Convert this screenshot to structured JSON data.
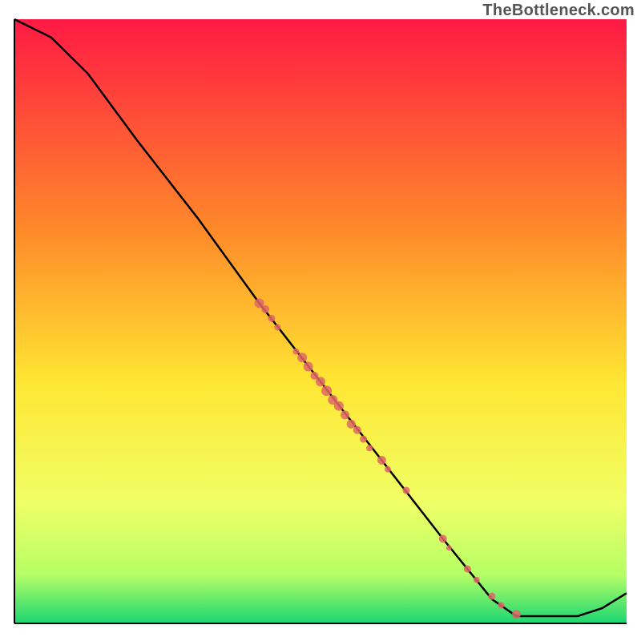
{
  "watermark": "TheBottleneck.com",
  "colors": {
    "gradient_top": "#ff1a44",
    "gradient_mid_upper": "#ff8a2a",
    "gradient_mid": "#ffe633",
    "gradient_mid_lower": "#f0ff66",
    "gradient_lower": "#b5ff66",
    "gradient_bottom": "#1bd672",
    "curve": "#000000",
    "dots": "#e06666",
    "axes": "#000000"
  },
  "chart_data": {
    "type": "line",
    "title": "",
    "xlabel": "",
    "ylabel": "",
    "xlim": [
      0,
      100
    ],
    "ylim": [
      0,
      100
    ],
    "curves": [
      {
        "name": "bottleneck_curve",
        "points": [
          {
            "x": 0,
            "y": 100
          },
          {
            "x": 6,
            "y": 97
          },
          {
            "x": 12,
            "y": 91
          },
          {
            "x": 20,
            "y": 80
          },
          {
            "x": 30,
            "y": 67
          },
          {
            "x": 40,
            "y": 53
          },
          {
            "x": 50,
            "y": 40
          },
          {
            "x": 60,
            "y": 27
          },
          {
            "x": 70,
            "y": 14
          },
          {
            "x": 78,
            "y": 4
          },
          {
            "x": 82,
            "y": 1.2
          },
          {
            "x": 86,
            "y": 1.2
          },
          {
            "x": 92,
            "y": 1.2
          },
          {
            "x": 96,
            "y": 2.5
          },
          {
            "x": 100,
            "y": 5
          }
        ]
      }
    ],
    "scatter_points": [
      {
        "x": 40,
        "y": 53,
        "size": 12
      },
      {
        "x": 41,
        "y": 52,
        "size": 10
      },
      {
        "x": 42,
        "y": 50.5,
        "size": 9
      },
      {
        "x": 43,
        "y": 49,
        "size": 8
      },
      {
        "x": 46,
        "y": 45,
        "size": 8
      },
      {
        "x": 47,
        "y": 44,
        "size": 12
      },
      {
        "x": 48,
        "y": 42.5,
        "size": 12
      },
      {
        "x": 49,
        "y": 41,
        "size": 10
      },
      {
        "x": 50,
        "y": 40,
        "size": 12
      },
      {
        "x": 51,
        "y": 38.5,
        "size": 13
      },
      {
        "x": 52,
        "y": 37,
        "size": 12
      },
      {
        "x": 53,
        "y": 36,
        "size": 12
      },
      {
        "x": 54,
        "y": 34.5,
        "size": 11
      },
      {
        "x": 55,
        "y": 33,
        "size": 11
      },
      {
        "x": 56,
        "y": 32,
        "size": 10
      },
      {
        "x": 57,
        "y": 30.5,
        "size": 9
      },
      {
        "x": 58,
        "y": 29,
        "size": 8
      },
      {
        "x": 60,
        "y": 27,
        "size": 11
      },
      {
        "x": 61,
        "y": 25.5,
        "size": 8
      },
      {
        "x": 64,
        "y": 22,
        "size": 9
      },
      {
        "x": 70,
        "y": 14,
        "size": 10
      },
      {
        "x": 71,
        "y": 12.5,
        "size": 7
      },
      {
        "x": 74,
        "y": 9,
        "size": 9
      },
      {
        "x": 75.5,
        "y": 7.2,
        "size": 8
      },
      {
        "x": 78,
        "y": 4.5,
        "size": 9
      },
      {
        "x": 79.5,
        "y": 3,
        "size": 8
      },
      {
        "x": 82,
        "y": 1.5,
        "size": 11
      }
    ]
  }
}
